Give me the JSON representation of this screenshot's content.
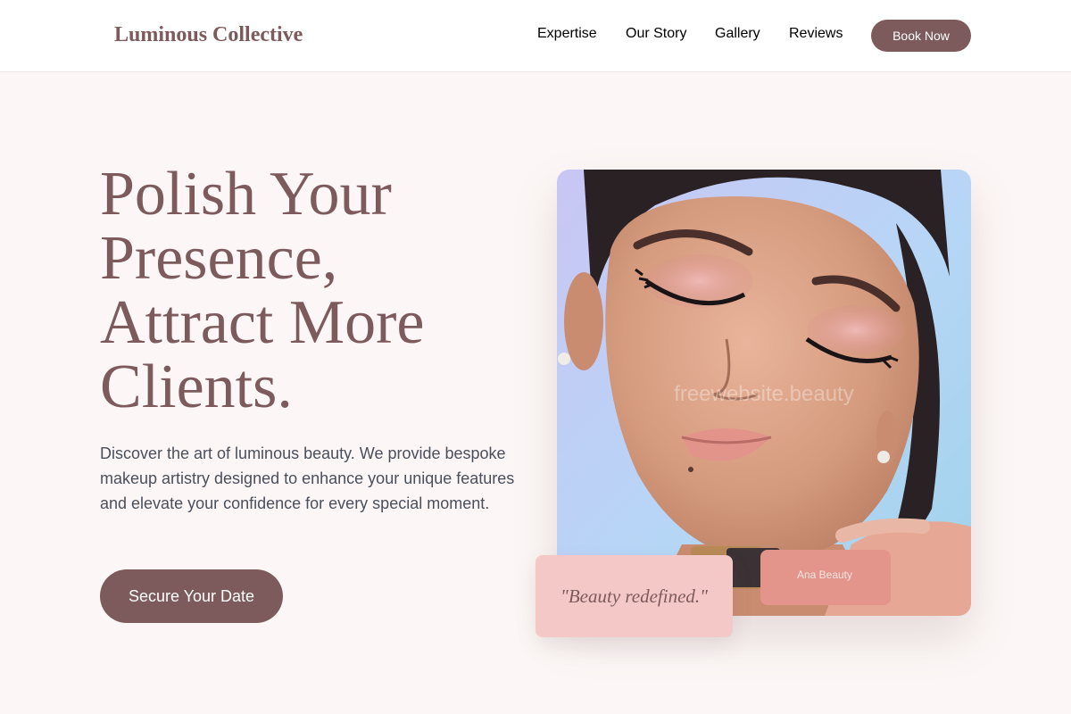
{
  "header": {
    "logo": "Luminous Collective",
    "nav": [
      "Expertise",
      "Our Story",
      "Gallery",
      "Reviews"
    ],
    "book_label": "Book Now"
  },
  "hero": {
    "title_lines": [
      "Polish Your",
      "Presence,",
      "Attract More",
      "Clients."
    ],
    "description": "Discover the art of luminous beauty. We provide bespoke makeup artistry designed to enhance your unique features and elevate your confidence for every special moment.",
    "cta_label": "Secure Your Date"
  },
  "image": {
    "watermark": "freewebsite.beauty",
    "lipstick_text": "Ana Beauty"
  },
  "quote": "\"Beauty redefined.\"",
  "colors": {
    "brand": "#7d5a5b",
    "background": "#fcf7f6",
    "quote_card": "#f3c8c7"
  }
}
